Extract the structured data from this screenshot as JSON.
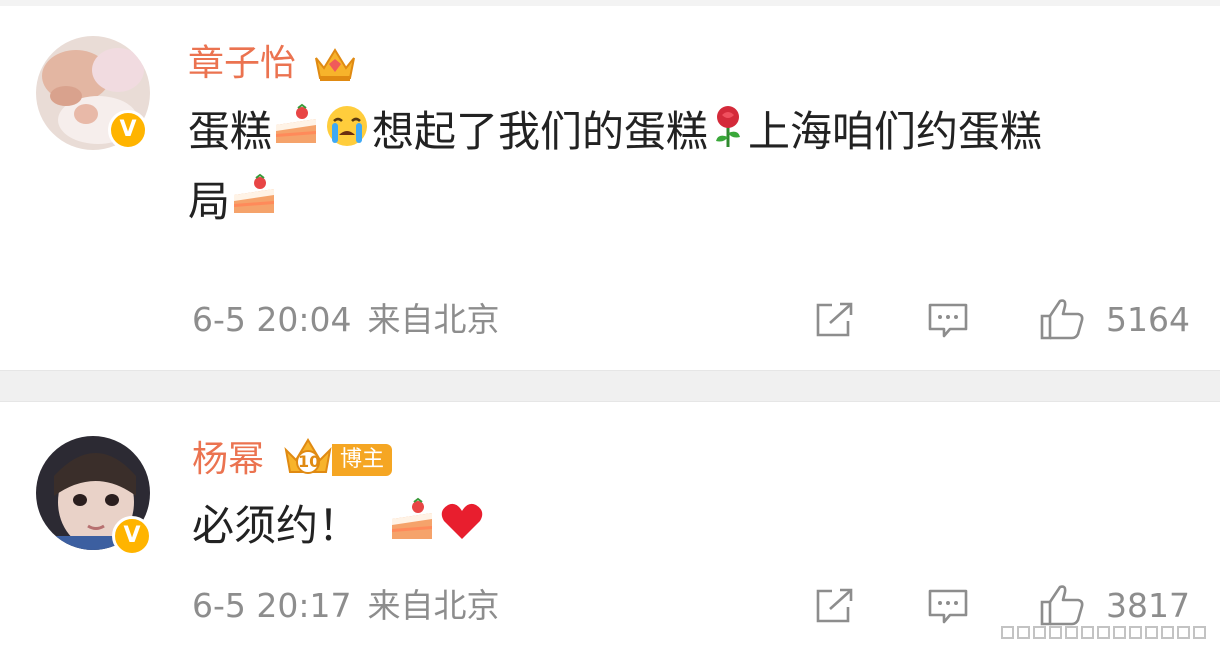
{
  "comments": [
    {
      "username": "章子怡",
      "text_parts": [
        "蛋糕",
        "想起了我们的蛋糕",
        "上海咱们约蛋糕",
        "局"
      ],
      "date": "6-5 20:04",
      "location": "来自北京",
      "likes": "5164",
      "verified_badge": "V"
    },
    {
      "username": "杨幂",
      "badge_label": "博主",
      "badge_level": "10",
      "text_parts": [
        "必须约！"
      ],
      "date": "6-5 20:17",
      "location": "来自北京",
      "likes": "3817",
      "verified_badge": "V"
    }
  ],
  "icons": [
    "crown-icon",
    "cake-emoji",
    "crying-emoji",
    "rose-emoji",
    "heart-emoji",
    "share-icon",
    "comment-icon",
    "like-icon"
  ],
  "colors": {
    "username": "#eb7350",
    "text": "#222222",
    "meta": "#8d8d8d",
    "badge": "#ffb400",
    "divider": "#f0f0f0"
  }
}
